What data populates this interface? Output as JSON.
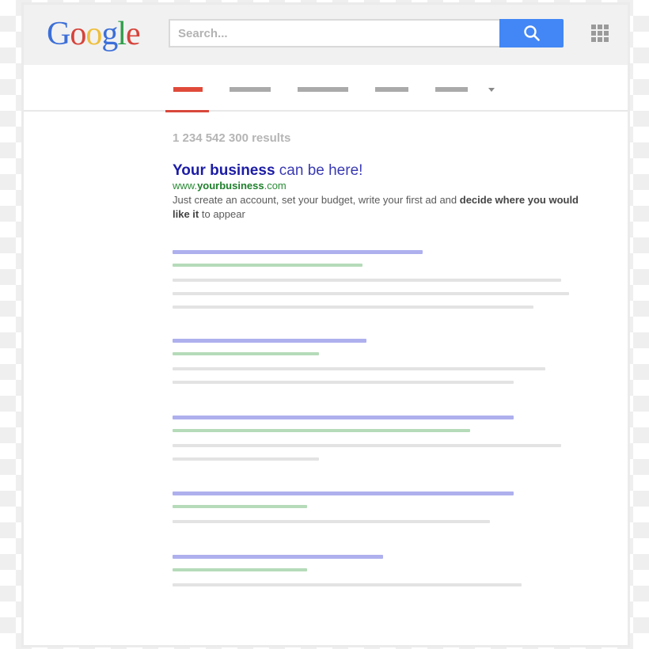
{
  "header": {
    "logo": {
      "letters": [
        {
          "char": "G",
          "color": "#3c6fd8"
        },
        {
          "char": "o",
          "color": "#d6433a"
        },
        {
          "char": "o",
          "color": "#efbf3b"
        },
        {
          "char": "g",
          "color": "#3c6fd8"
        },
        {
          "char": "l",
          "color": "#2f9e4a"
        },
        {
          "char": "e",
          "color": "#d6433a"
        }
      ]
    },
    "search": {
      "placeholder": "Search...",
      "value": "",
      "button_icon": "search-icon",
      "button_color": "#4287f5"
    },
    "apps_icon": "apps-grid-icon"
  },
  "tabs": {
    "items": [
      {
        "state": "active",
        "color": "#e04a3a"
      },
      {
        "state": "inactive",
        "color": "#aaaaaa"
      },
      {
        "state": "inactive",
        "color": "#aaaaaa"
      },
      {
        "state": "inactive",
        "color": "#aaaaaa"
      },
      {
        "state": "inactive",
        "color": "#aaaaaa"
      }
    ],
    "more_icon": "dropdown-triangle-icon"
  },
  "results": {
    "count_text": "1 234 542 300 results",
    "ad": {
      "title_bold": "Your business",
      "title_rest": " can be here!",
      "url_prefix": "www.",
      "url_bold": "yourbusiness",
      "url_suffix": ".com",
      "desc_part1": "Just create an account, set your budget, write your first ad and ",
      "desc_bold": "decide where you would like it",
      "desc_part2": " to appear"
    },
    "placeholder_results": [
      {
        "title_line_fraction": 0.63,
        "url_line_fraction": 0.48,
        "text_line_fractions": [
          0.98,
          1.0,
          0.91
        ]
      },
      {
        "title_line_fraction": 0.49,
        "url_line_fraction": 0.37,
        "text_line_fractions": [
          0.94,
          0.86
        ]
      },
      {
        "title_line_fraction": 0.86,
        "url_line_fraction": 0.75,
        "text_line_fractions": [
          0.98,
          0.37
        ]
      },
      {
        "title_line_fraction": 0.86,
        "url_line_fraction": 0.34,
        "text_line_fractions": [
          0.8
        ]
      },
      {
        "title_line_fraction": 0.53,
        "url_line_fraction": 0.34,
        "text_line_fractions": [
          0.88
        ]
      }
    ],
    "colors": {
      "title_line": "#aeb0ee",
      "url_line": "#b5dbb9",
      "text_line": "#e3e3e3"
    }
  }
}
